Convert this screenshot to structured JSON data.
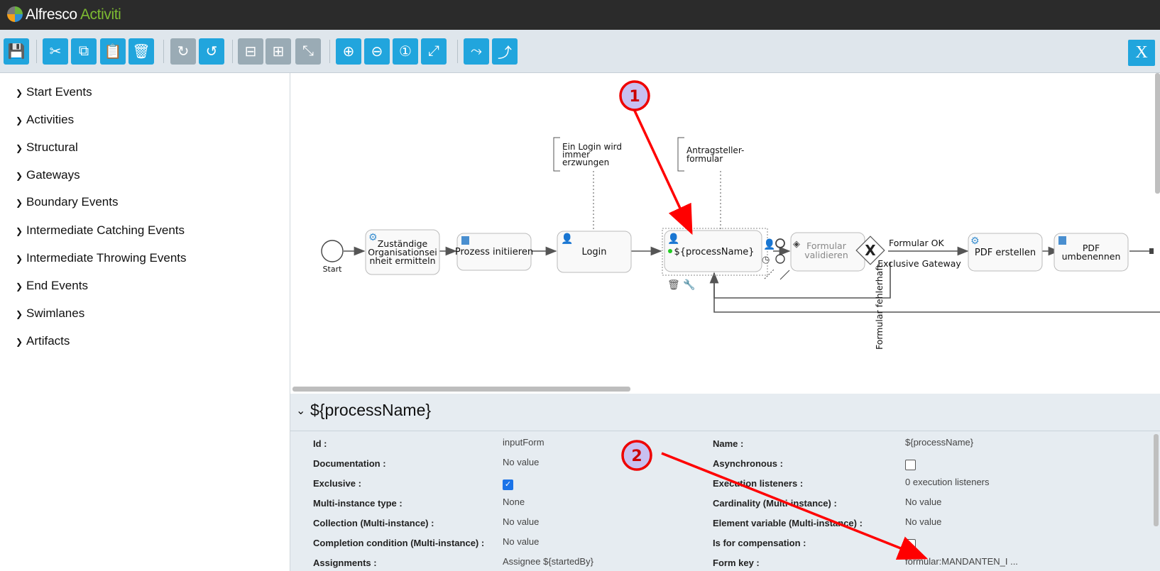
{
  "app": {
    "brand": "Alfresco",
    "brand_sub": "Activiti"
  },
  "toolbar": {
    "buttons": [
      {
        "icon": "save-icon",
        "glyph": "💾",
        "disabled": false
      },
      {
        "icon": "cut-icon",
        "glyph": "✂",
        "disabled": false
      },
      {
        "icon": "copy-icon",
        "glyph": "⧉",
        "disabled": false
      },
      {
        "icon": "paste-icon",
        "glyph": "📋",
        "disabled": false
      },
      {
        "icon": "delete-icon",
        "glyph": "🗑",
        "disabled": false
      },
      {
        "icon": "redo-icon",
        "glyph": "↻",
        "disabled": true
      },
      {
        "icon": "undo-icon",
        "glyph": "↺",
        "disabled": false
      },
      {
        "icon": "align-vertical-icon",
        "glyph": "⊟",
        "disabled": true
      },
      {
        "icon": "align-horizontal-icon",
        "glyph": "⊞",
        "disabled": true
      },
      {
        "icon": "same-size-icon",
        "glyph": "⤡",
        "disabled": true
      },
      {
        "icon": "zoom-in-icon",
        "glyph": "⊕",
        "disabled": false
      },
      {
        "icon": "zoom-out-icon",
        "glyph": "⊖",
        "disabled": false
      },
      {
        "icon": "zoom-actual-icon",
        "glyph": "①",
        "disabled": false
      },
      {
        "icon": "zoom-fit-icon",
        "glyph": "⤢",
        "disabled": false
      },
      {
        "icon": "add-bendpoint-icon",
        "glyph": "⤳",
        "disabled": false
      },
      {
        "icon": "remove-bendpoint-icon",
        "glyph": "⤴",
        "disabled": false
      }
    ],
    "close_label": "X"
  },
  "palette": {
    "items": [
      "Start Events",
      "Activities",
      "Structural",
      "Gateways",
      "Boundary Events",
      "Intermediate Catching Events",
      "Intermediate Throwing Events",
      "End Events",
      "Swimlanes",
      "Artifacts"
    ]
  },
  "diagram": {
    "start_label": "Start",
    "task1": [
      "Zuständige",
      "Organisationsei",
      "nheit ermitteln"
    ],
    "task2": "Prozess initiieren",
    "task3": "Login",
    "task4": "${processName}",
    "task5": [
      "Formular",
      "validieren"
    ],
    "gateway_label": "Exclusive Gateway",
    "flow_ok": "Formular OK",
    "flow_bad": "Formular fehlerhaft",
    "task6": "PDF erstellen",
    "task7": [
      "PDF",
      "umbenennen"
    ],
    "annotation1": [
      "Ein Login wird",
      "immer",
      "erzwungen"
    ],
    "annotation2": [
      "Antragsteller-",
      "formular"
    ],
    "callout1": "1",
    "callout2": "2"
  },
  "properties": {
    "title": "${processName}",
    "left": [
      {
        "label": "Id :",
        "value": "inputForm"
      },
      {
        "label": "Documentation :",
        "value": "No value"
      },
      {
        "label": "Exclusive :",
        "value": "",
        "checkbox": true,
        "checked": true
      },
      {
        "label": "Multi-instance type :",
        "value": "None"
      },
      {
        "label": "Collection (Multi-instance) :",
        "value": "No value"
      },
      {
        "label": "Completion condition (Multi-instance) :",
        "value": "No value"
      },
      {
        "label": "Assignments :",
        "value": "Assignee ${startedBy}"
      }
    ],
    "right": [
      {
        "label": "Name :",
        "value": "${processName}"
      },
      {
        "label": "Asynchronous :",
        "value": "",
        "checkbox": true,
        "checked": false
      },
      {
        "label": "Execution listeners :",
        "value": "0 execution listeners"
      },
      {
        "label": "Cardinality (Multi-instance) :",
        "value": "No value"
      },
      {
        "label": "Element variable (Multi-instance) :",
        "value": "No value"
      },
      {
        "label": "Is for compensation :",
        "value": "",
        "checkbox": true,
        "checked": false
      },
      {
        "label": "Form key :",
        "value": "formular:MANDANTEN_I ..."
      }
    ]
  }
}
